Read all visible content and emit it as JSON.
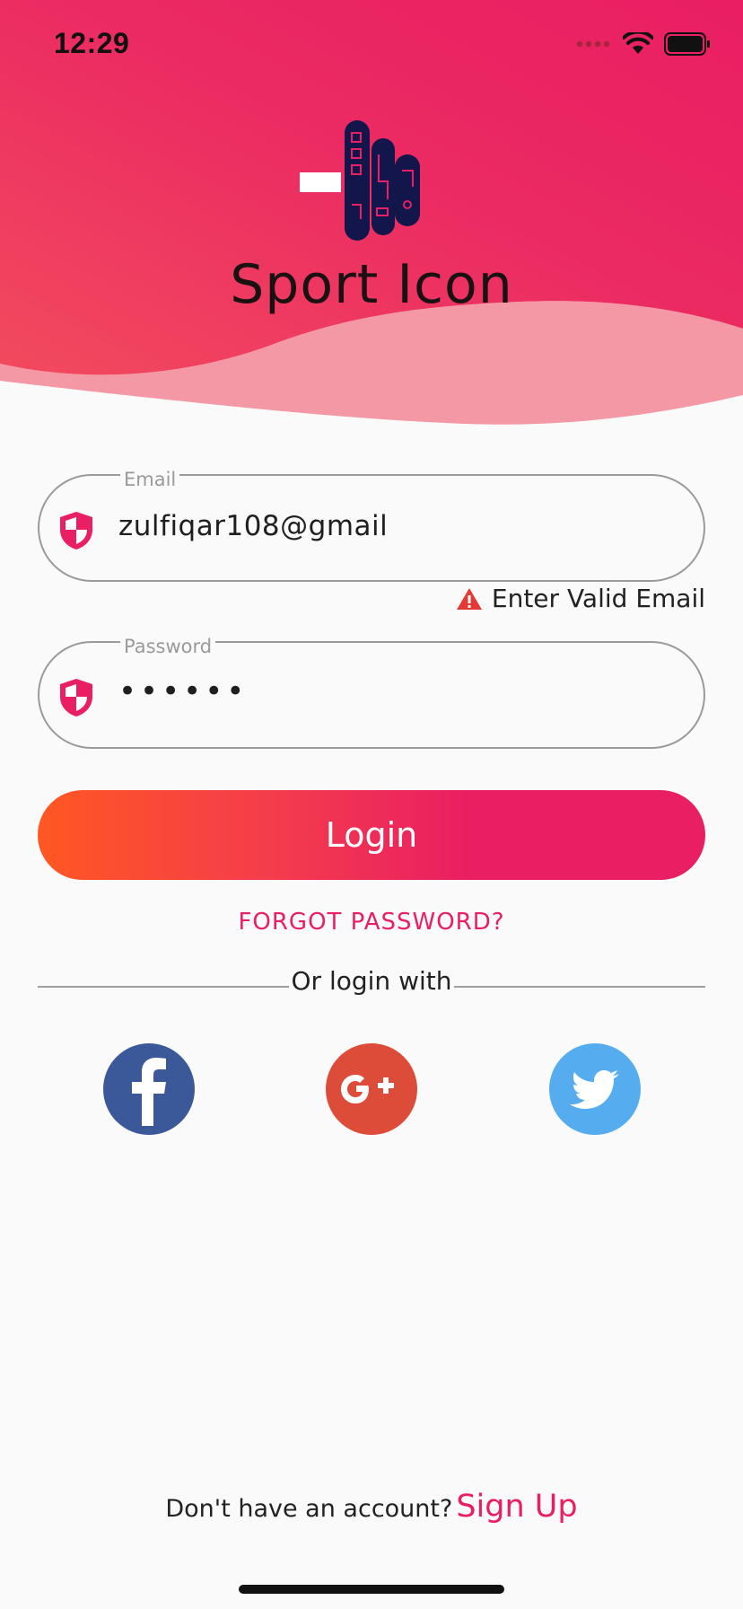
{
  "status_bar": {
    "time": "12:29"
  },
  "app": {
    "title": "Sport Icon"
  },
  "form": {
    "email": {
      "label": "Email",
      "value": "zulfiqar108@gmail",
      "error": "Enter Valid Email"
    },
    "password": {
      "label": "Password",
      "value": "••••••"
    }
  },
  "actions": {
    "login_label": "Login",
    "forgot_label": "FORGOT PASSWORD?"
  },
  "social": {
    "divider_label": "Or login with",
    "buttons": [
      {
        "name": "facebook",
        "icon": "facebook-icon",
        "color": "#3b5998"
      },
      {
        "name": "google-plus",
        "icon": "google-plus-icon",
        "color": "#dd4b39"
      },
      {
        "name": "twitter",
        "icon": "twitter-icon",
        "color": "#55acee"
      }
    ]
  },
  "footer": {
    "question": "Don't have an account?",
    "signup_label": "Sign Up"
  },
  "colors": {
    "accent": "#e91e63",
    "gradient_start": "#ff5722",
    "header_wave_light": "#f498a6"
  }
}
